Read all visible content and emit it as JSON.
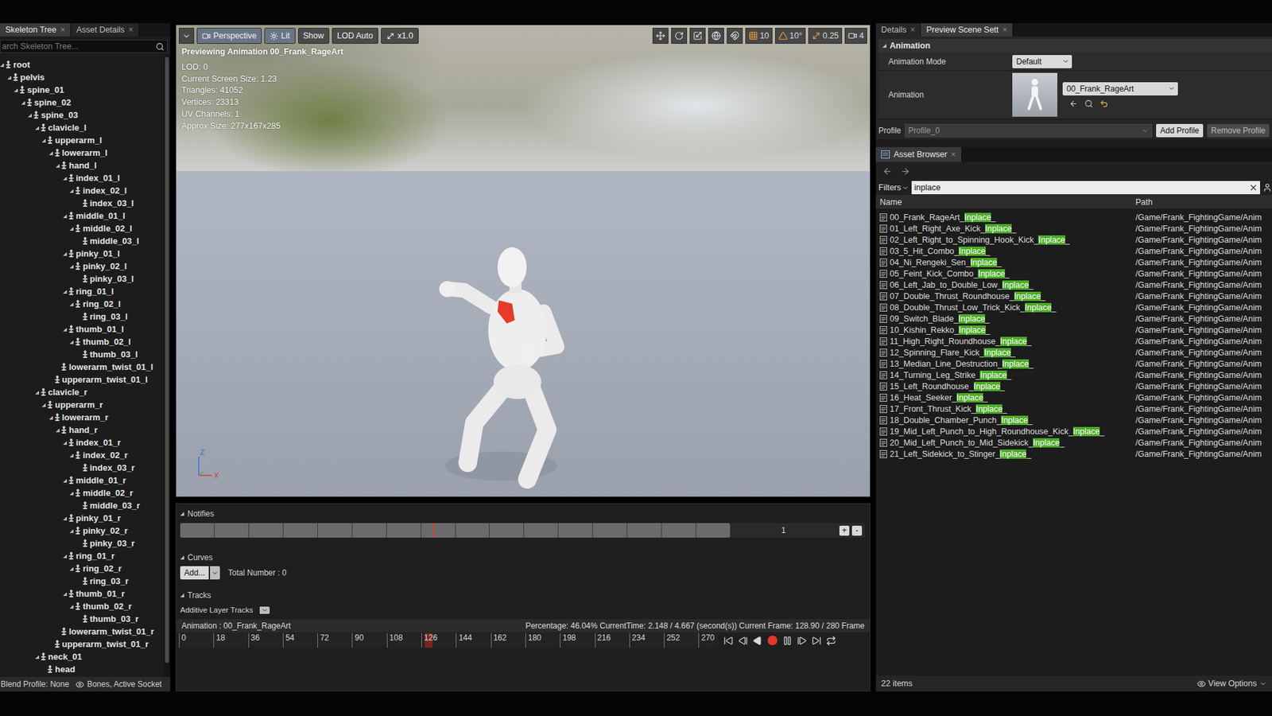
{
  "skeleton_panel": {
    "tabs": [
      {
        "label": "Skeleton Tree",
        "selected": true,
        "close": "×"
      },
      {
        "label": "Asset Details",
        "selected": false,
        "close": "×"
      }
    ],
    "search": {
      "placeholder": "arch Skeleton Tree..."
    },
    "bones": [
      {
        "name": "root",
        "depth": 0,
        "expanded": true
      },
      {
        "name": "pelvis",
        "depth": 1,
        "expanded": true
      },
      {
        "name": "spine_01",
        "depth": 2,
        "expanded": true
      },
      {
        "name": "spine_02",
        "depth": 3,
        "expanded": true
      },
      {
        "name": "spine_03",
        "depth": 4,
        "expanded": true
      },
      {
        "name": "clavicle_l",
        "depth": 5,
        "expanded": true
      },
      {
        "name": "upperarm_l",
        "depth": 6,
        "expanded": true
      },
      {
        "name": "lowerarm_l",
        "depth": 7,
        "expanded": true
      },
      {
        "name": "hand_l",
        "depth": 8,
        "expanded": true
      },
      {
        "name": "index_01_l",
        "depth": 9,
        "expanded": true
      },
      {
        "name": "index_02_l",
        "depth": 10,
        "expanded": true
      },
      {
        "name": "index_03_l",
        "depth": 11,
        "expanded": false
      },
      {
        "name": "middle_01_l",
        "depth": 9,
        "expanded": true
      },
      {
        "name": "middle_02_l",
        "depth": 10,
        "expanded": true
      },
      {
        "name": "middle_03_l",
        "depth": 11,
        "expanded": false
      },
      {
        "name": "pinky_01_l",
        "depth": 9,
        "expanded": true
      },
      {
        "name": "pinky_02_l",
        "depth": 10,
        "expanded": true
      },
      {
        "name": "pinky_03_l",
        "depth": 11,
        "expanded": false
      },
      {
        "name": "ring_01_l",
        "depth": 9,
        "expanded": true
      },
      {
        "name": "ring_02_l",
        "depth": 10,
        "expanded": true
      },
      {
        "name": "ring_03_l",
        "depth": 11,
        "expanded": false
      },
      {
        "name": "thumb_01_l",
        "depth": 9,
        "expanded": true
      },
      {
        "name": "thumb_02_l",
        "depth": 10,
        "expanded": true
      },
      {
        "name": "thumb_03_l",
        "depth": 11,
        "expanded": false
      },
      {
        "name": "lowerarm_twist_01_l",
        "depth": 8,
        "expanded": false
      },
      {
        "name": "upperarm_twist_01_l",
        "depth": 7,
        "expanded": false
      },
      {
        "name": "clavicle_r",
        "depth": 5,
        "expanded": true
      },
      {
        "name": "upperarm_r",
        "depth": 6,
        "expanded": true
      },
      {
        "name": "lowerarm_r",
        "depth": 7,
        "expanded": true
      },
      {
        "name": "hand_r",
        "depth": 8,
        "expanded": true
      },
      {
        "name": "index_01_r",
        "depth": 9,
        "expanded": true
      },
      {
        "name": "index_02_r",
        "depth": 10,
        "expanded": true
      },
      {
        "name": "index_03_r",
        "depth": 11,
        "expanded": false
      },
      {
        "name": "middle_01_r",
        "depth": 9,
        "expanded": true
      },
      {
        "name": "middle_02_r",
        "depth": 10,
        "expanded": true
      },
      {
        "name": "middle_03_r",
        "depth": 11,
        "expanded": false
      },
      {
        "name": "pinky_01_r",
        "depth": 9,
        "expanded": true
      },
      {
        "name": "pinky_02_r",
        "depth": 10,
        "expanded": true
      },
      {
        "name": "pinky_03_r",
        "depth": 11,
        "expanded": false
      },
      {
        "name": "ring_01_r",
        "depth": 9,
        "expanded": true
      },
      {
        "name": "ring_02_r",
        "depth": 10,
        "expanded": true
      },
      {
        "name": "ring_03_r",
        "depth": 11,
        "expanded": false
      },
      {
        "name": "thumb_01_r",
        "depth": 9,
        "expanded": true
      },
      {
        "name": "thumb_02_r",
        "depth": 10,
        "expanded": true
      },
      {
        "name": "thumb_03_r",
        "depth": 11,
        "expanded": false
      },
      {
        "name": "lowerarm_twist_01_r",
        "depth": 8,
        "expanded": false
      },
      {
        "name": "upperarm_twist_01_r",
        "depth": 7,
        "expanded": false
      },
      {
        "name": "neck_01",
        "depth": 5,
        "expanded": true
      },
      {
        "name": "head",
        "depth": 6,
        "expanded": false
      }
    ],
    "footer": {
      "blend_profile": "Blend Profile: None",
      "filter": "Bones, Active Socket"
    }
  },
  "viewport": {
    "toolbar_left": [
      {
        "label": "Perspective",
        "active": true
      },
      {
        "label": "Lit",
        "active": true
      },
      {
        "label": "Show",
        "active": false
      },
      {
        "label": "LOD Auto",
        "active": false
      },
      {
        "label": "x1.0",
        "active": false
      }
    ],
    "toolbar_right": {
      "grid": "10",
      "angle": "10°",
      "scale": "0.25",
      "camera": "4"
    },
    "title": "Previewing Animation 00_Frank_RageArt",
    "stats": [
      "LOD: 0",
      "Current Screen Size: 1.23",
      "Triangles: 41052",
      "Vertices: 23313",
      "UV Channels: 1",
      "Approx Size: 277x167x285"
    ],
    "axis": {
      "z": "Z",
      "x": "X"
    }
  },
  "timeline": {
    "notifies": {
      "title": "Notifies",
      "count": "1",
      "plus": "+",
      "minus": "-"
    },
    "curves": {
      "title": "Curves",
      "add": "Add...",
      "total": "Total Number : 0"
    },
    "tracks": {
      "title": "Tracks",
      "additive": "Additive Layer Tracks"
    },
    "status": {
      "animation": "Animation : 00_Frank_RageArt",
      "info": "Percentage:  46.04% CurrentTime: 2.148 / 4.667 (second(s)) Current Frame: 128.90 / 280 Frame"
    },
    "ruler_ticks": [
      "0",
      "18",
      "36",
      "54",
      "72",
      "90",
      "108",
      "126",
      "144",
      "162",
      "180",
      "198",
      "216",
      "234",
      "252",
      "270"
    ],
    "playhead": {
      "level": 0.4604
    }
  },
  "details_panel": {
    "tabs": [
      {
        "label": "Details",
        "selected": false,
        "close": "×"
      },
      {
        "label": "Preview Scene Sett",
        "selected": true,
        "close": "×"
      }
    ],
    "section": "Animation",
    "animation_mode": {
      "label": "Animation Mode",
      "value": "Default"
    },
    "animation": {
      "label": "Animation",
      "asset": "00_Frank_RageArt"
    },
    "profile": {
      "label": "Profile",
      "value": "Profile_0",
      "buttons": [
        "Add Profile",
        "Remove Profile"
      ]
    }
  },
  "asset_browser": {
    "tab": {
      "label": "Asset Browser",
      "close": "×"
    },
    "filters": "Filters",
    "search": "inplace",
    "columns": [
      "Name",
      "Path"
    ],
    "items": [
      {
        "name": "00_Frank_RageArt_Inplace_",
        "path": "/Game/Frank_FightingGame/Anim"
      },
      {
        "name": "01_Left_Right_Axe_Kick_Inplace_",
        "path": "/Game/Frank_FightingGame/Anim"
      },
      {
        "name": "02_Left_Right_to_Spinning_Hook_Kick_Inplace_",
        "path": "/Game/Frank_FightingGame/Anim"
      },
      {
        "name": "03_5_Hit_Combo_Inplace_",
        "path": "/Game/Frank_FightingGame/Anim"
      },
      {
        "name": "04_Ni_Rengeki_Sen_Inplace_",
        "path": "/Game/Frank_FightingGame/Anim"
      },
      {
        "name": "05_Feint_Kick_Combo_Inplace_",
        "path": "/Game/Frank_FightingGame/Anim"
      },
      {
        "name": "06_Left_Jab_to_Double_Low_Inplace_",
        "path": "/Game/Frank_FightingGame/Anim"
      },
      {
        "name": "07_Double_Thrust_Roundhouse_Inplace_",
        "path": "/Game/Frank_FightingGame/Anim"
      },
      {
        "name": "08_Double_Thrust_Low_Trick_Kick_Inplace_",
        "path": "/Game/Frank_FightingGame/Anim"
      },
      {
        "name": "09_Switch_Blade_Inplace_",
        "path": "/Game/Frank_FightingGame/Anim"
      },
      {
        "name": "10_Kishin_Rekko_Inplace_",
        "path": "/Game/Frank_FightingGame/Anim"
      },
      {
        "name": "11_High_Right_Roundhouse_Inplace_",
        "path": "/Game/Frank_FightingGame/Anim"
      },
      {
        "name": "12_Spinning_Flare_Kick_Inplace_",
        "path": "/Game/Frank_FightingGame/Anim"
      },
      {
        "name": "13_Median_Line_Destruction_Inplace_",
        "path": "/Game/Frank_FightingGame/Anim"
      },
      {
        "name": "14_Turning_Leg_Strike_Inplace_",
        "path": "/Game/Frank_FightingGame/Anim"
      },
      {
        "name": "15_Left_Roundhouse_Inplace_",
        "path": "/Game/Frank_FightingGame/Anim"
      },
      {
        "name": "16_Heat_Seeker_Inplace_",
        "path": "/Game/Frank_FightingGame/Anim"
      },
      {
        "name": "17_Front_Thrust_Kick_Inplace_",
        "path": "/Game/Frank_FightingGame/Anim"
      },
      {
        "name": "18_Double_Chamber_Punch_Inplace_",
        "path": "/Game/Frank_FightingGame/Anim"
      },
      {
        "name": "19_Mid_Left_Punch_to_High_Roundhouse_Kick_Inplace_",
        "path": "/Game/Frank_FightingGame/Anim"
      },
      {
        "name": "20_Mid_Left_Punch_to_Mid_Sidekick_Inplace_",
        "path": "/Game/Frank_FightingGame/Anim"
      },
      {
        "name": "21_Left_Sidekick_to_Stinger_Inplace_",
        "path": "/Game/Frank_FightingGame/Anim"
      }
    ],
    "count": "22 items",
    "view_options": "View Options"
  }
}
